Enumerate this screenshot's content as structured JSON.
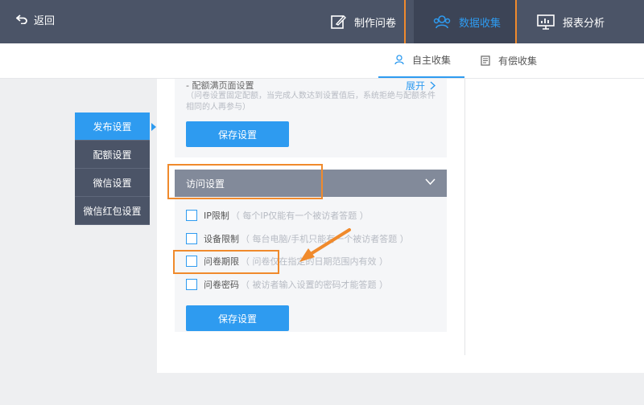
{
  "topbar": {
    "back_label": "返回",
    "nav": [
      {
        "label": "制作问卷",
        "icon": "edit-icon"
      },
      {
        "label": "数据收集",
        "icon": "users-icon",
        "active": true
      },
      {
        "label": "报表分析",
        "icon": "chart-icon"
      }
    ]
  },
  "subtabs": [
    {
      "label": "自主收集",
      "icon": "user-icon",
      "active": true
    },
    {
      "label": "有偿收集",
      "icon": "document-icon"
    }
  ],
  "sidemenu": [
    {
      "label": "发布设置",
      "active": true
    },
    {
      "label": "配额设置"
    },
    {
      "label": "微信设置"
    },
    {
      "label": "微信红包设置"
    }
  ],
  "quota": {
    "title": "- 配额满页面设置",
    "expand_label": "展开",
    "desc": "（问卷设置固定配额，当完成人数达到设置值后，系统拒绝与配额条件相同的人再参与）",
    "save_label": "保存设置"
  },
  "visit": {
    "title": "访问设置",
    "options": [
      {
        "label": "IP限制",
        "desc": "（ 每个IP仅能有一个被访者答题 ）",
        "checked": false
      },
      {
        "label": "设备限制",
        "desc": "（ 每台电脑/手机只能有一个被访者答题 ）",
        "checked": false
      },
      {
        "label": "问卷期限",
        "desc": "（ 问卷仅在指定的日期范围内有效 ）",
        "checked": false
      },
      {
        "label": "问卷密码",
        "desc": "（ 被访者输入设置的密码才能答题 ）",
        "checked": false
      }
    ],
    "save_label": "保存设置"
  },
  "colors": {
    "accent": "#2e9bf0",
    "topbar": "#4b5467",
    "highlight": "#f08a2c"
  }
}
